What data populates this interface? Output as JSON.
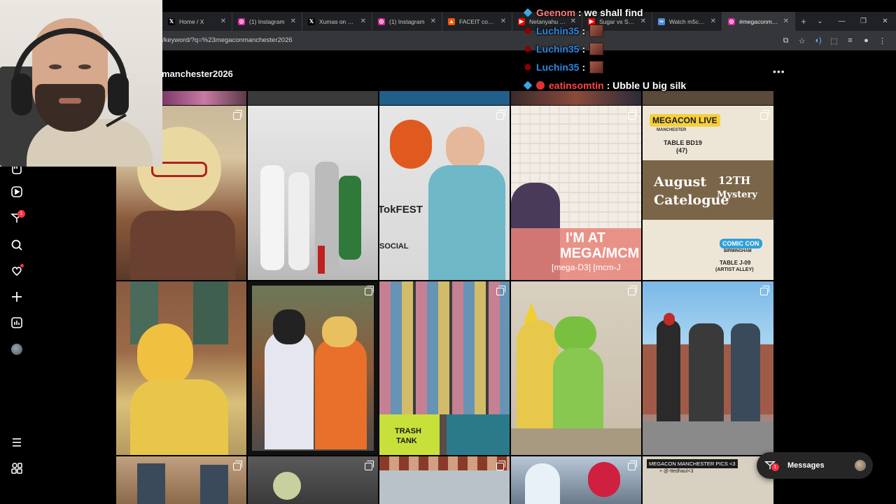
{
  "browser": {
    "tabs": [
      {
        "title": "Home / X",
        "favicon": "x-icon",
        "color": "#000000",
        "glyph": "𝕏"
      },
      {
        "title": "(1) Instagram",
        "favicon": "instagram-icon",
        "color": "#d6249f",
        "glyph": "◎"
      },
      {
        "title": "Xumas on X: \"...",
        "favicon": "x-icon",
        "color": "#000000",
        "glyph": "𝕏"
      },
      {
        "title": "(1) Instagram",
        "favicon": "instagram-icon",
        "color": "#d6249f",
        "glyph": "◎"
      },
      {
        "title": "FACEIT compet...",
        "favicon": "faceit-icon",
        "color": "#ff5500",
        "glyph": "▲"
      },
      {
        "title": "Netanyahu co...",
        "favicon": "youtube-icon",
        "color": "#ff0000",
        "glyph": "▶"
      },
      {
        "title": "Sugar vs Spicy...",
        "favicon": "youtube-icon",
        "color": "#ff0000",
        "glyph": "▶"
      },
      {
        "title": "Watch m5c2u8...",
        "favicon": "generic-icon",
        "color": "#4a90d9",
        "glyph": "∞"
      },
      {
        "title": "#megaconman...",
        "favicon": "instagram-icon",
        "color": "#d6249f",
        "glyph": "◎",
        "active": true
      }
    ],
    "new_tab": "+",
    "url": "/keyword/?q=%23megaconmanchester2026"
  },
  "sidebar": {
    "items": [
      {
        "name": "reels-icon",
        "glyph": "▶"
      },
      {
        "name": "messages-icon",
        "glyph": "✉",
        "badge": "1"
      },
      {
        "name": "search-icon",
        "glyph": "⌕"
      },
      {
        "name": "notifications-icon",
        "glyph": "♡"
      },
      {
        "name": "create-icon",
        "glyph": "+"
      },
      {
        "name": "dashboard-icon",
        "glyph": "▥"
      },
      {
        "name": "profile-icon",
        "glyph": ""
      }
    ],
    "more": "☰",
    "meta": "⊞"
  },
  "main": {
    "title": "manchester2026",
    "more": "•••"
  },
  "tiles": {
    "mega_con_logo": "MEGACON LIVE",
    "mega_con_sub": "MANCHESTER",
    "table_bd19": "TABLE BD19",
    "table_bd19_sub": "(47)",
    "august": "August",
    "catelogue": "Catelogue",
    "twelfth": "12TH",
    "mystery": "Mystery",
    "comic_con": "COMIC CON",
    "birmingham": "BIRMINGHAM",
    "table_j09": "TABLE J-09",
    "artist_alley": "(ARTIST ALLEY)",
    "im_at": "I'M AT",
    "mega_mcm": "MEGA/MCM",
    "mega_d3": "[mega-D3] [mcm-J",
    "tokfest": "TokFEST",
    "social": "SOCIAL",
    "trash": "TRASH",
    "tank": "TANK",
    "pics_caption": "MEGACON MANCHESTER PICS <3",
    "pics_handle": "+ @-ttedhaul<3"
  },
  "messages_pill": {
    "label": "Messages",
    "badge": "1"
  },
  "chat": {
    "lines": [
      {
        "user": "Geenom",
        "color": "#ff7f7f",
        "msg": ": we shall find",
        "badge": "cube"
      },
      {
        "user": "Luchin35",
        "color": "#2e86de",
        "msg": ":",
        "badge": "red",
        "emote": true
      },
      {
        "user": "Luchin35",
        "color": "#2e86de",
        "msg": ":",
        "badge": "red",
        "emote": true
      },
      {
        "user": "Luchin35",
        "color": "#2e86de",
        "msg": ":",
        "badge": "red",
        "emote": true
      },
      {
        "user": "eatinsomtin",
        "color": "#ff4444",
        "msg": ": Ubble U big silk",
        "badge": "cube",
        "badge2": true
      }
    ]
  }
}
